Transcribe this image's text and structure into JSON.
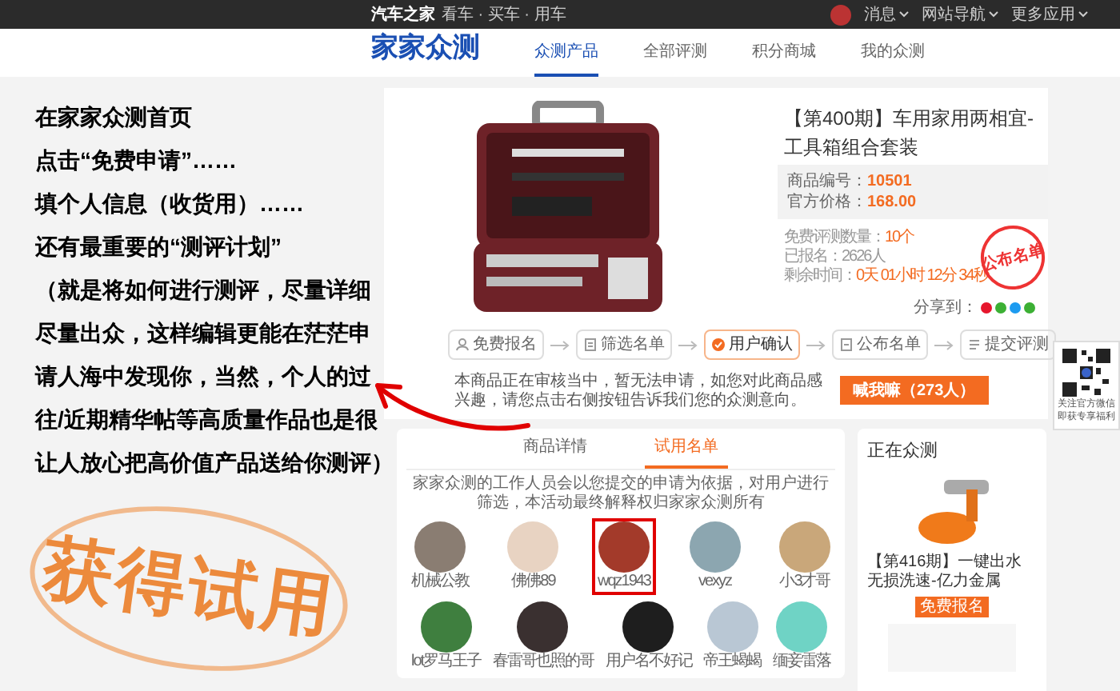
{
  "top_bar": {
    "brand": "汽车之家",
    "tagline": "看车 · 买车 · 用车",
    "menus": [
      {
        "label": "消息"
      },
      {
        "label": "网站导航"
      },
      {
        "label": "更多应用"
      }
    ]
  },
  "nav": {
    "logo": "家家众测",
    "tabs": [
      {
        "label": "众测产品",
        "selected": true
      },
      {
        "label": "全部评测",
        "selected": false
      },
      {
        "label": "积分商城",
        "selected": false
      },
      {
        "label": "我的众测",
        "selected": false
      }
    ]
  },
  "guide": {
    "lines": [
      "在家家众测首页",
      "点击“免费申请”……",
      "填个人信息（收货用）……",
      "还有最重要的“测评计划”",
      "（就是将如何进行测评，尽量详细",
      "尽量出众，这样编辑更能在茫茫申",
      "请人海中发现你，当然，个人的过",
      "往/近期精华帖等高质量作品也是很",
      "让人放心把高价值产品送给你测评）"
    ],
    "stamp": "获得试用"
  },
  "product": {
    "title": "【第400期】车用家用两相宜-工具箱组合套装",
    "specs": [
      {
        "label": "商品编号：",
        "value": "10501"
      },
      {
        "label": "官方价格：",
        "value": "168.00"
      }
    ],
    "stats": [
      {
        "label": "免费评测数量：",
        "value": "10个",
        "highlight": true
      },
      {
        "label": "已报名：",
        "value": "2626人",
        "highlight": false
      },
      {
        "label": "剩余时间：",
        "value": "0天 01小时 12分 34秒",
        "highlight": true
      }
    ],
    "stamp": "公布名单",
    "share_label": "分享到：",
    "share_icons": [
      {
        "color": "#e6162d"
      },
      {
        "color": "#3cb034"
      },
      {
        "color": "#1d9bf0"
      },
      {
        "color": "#3cb034"
      }
    ],
    "steps": [
      {
        "label": "免费报名",
        "kind": "person",
        "selected": false
      },
      {
        "label": "筛选名单",
        "kind": "list",
        "selected": false
      },
      {
        "label": "用户确认",
        "kind": "check",
        "selected": true
      },
      {
        "label": "公布名单",
        "kind": "doc",
        "selected": false
      },
      {
        "label": "提交评测",
        "kind": "edit",
        "selected": false
      }
    ],
    "notice": "本商品正在审核当中，暂无法申请，如您对此商品感兴趣，请您点击右侧按钮告诉我们您的众测意向。",
    "button": "喊我嘛（273人）"
  },
  "qr": {
    "lines": [
      "关注官方微信",
      "即获专享福利"
    ]
  },
  "applicants": {
    "tabs": [
      {
        "label": "商品详情",
        "selected": false
      },
      {
        "label": "试用名单",
        "selected": true
      }
    ],
    "intro": "家家众测的工作人员会以您提交的申请为依据，对用户进行筛选，本活动最终解释权归家家众测所有",
    "users": [
      {
        "name": "机械公教",
        "highlighted": false
      },
      {
        "name": "佛佛89",
        "highlighted": false
      },
      {
        "name": "wqz1943",
        "highlighted": true
      },
      {
        "name": "vexyz",
        "highlighted": false
      },
      {
        "name": "小3才哥",
        "highlighted": false
      },
      {
        "name": "lot罗马王子",
        "highlighted": false
      },
      {
        "name": "春雷哥也照的哥",
        "highlighted": false
      },
      {
        "name": "用户名不好记",
        "highlighted": false
      },
      {
        "name": "帝王蝎蝎",
        "highlighted": false
      },
      {
        "name": "缅妾雷落",
        "highlighted": false
      }
    ]
  },
  "sidebar": {
    "title": "正在众测",
    "items": [
      {
        "title": "【第416期】一键出水无损洗速-亿力金属",
        "button": "免费报名"
      }
    ]
  }
}
